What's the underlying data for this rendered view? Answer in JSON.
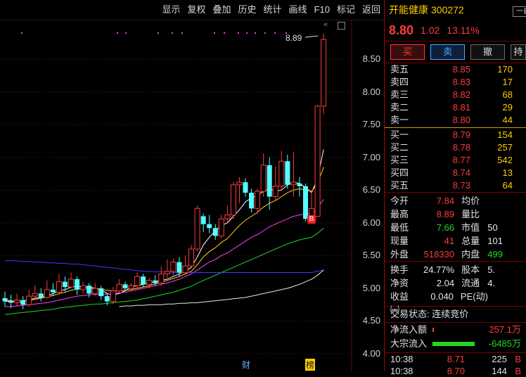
{
  "toolbar": {
    "items": [
      "显示",
      "复权",
      "叠加",
      "历史",
      "统计",
      "画线",
      "F10",
      "标记",
      "返回"
    ]
  },
  "chart": {
    "y_ticks": [
      "8.50",
      "8.00",
      "7.50",
      "7.00",
      "6.50",
      "6.00",
      "5.50",
      "5.00",
      "4.50",
      "4.00"
    ],
    "high_label": "8.89",
    "b_marker": "B",
    "bottom_markers": [
      "财",
      "榜"
    ]
  },
  "chart_data": {
    "type": "candlestick",
    "ylim": [
      3.9,
      8.95
    ],
    "candles": [
      [
        4.85,
        4.8,
        4.95,
        4.72
      ],
      [
        4.8,
        4.78,
        4.9,
        4.7
      ],
      [
        4.78,
        4.82,
        4.92,
        4.72
      ],
      [
        4.82,
        4.75,
        4.88,
        4.68
      ],
      [
        4.75,
        4.88,
        4.98,
        4.72
      ],
      [
        4.88,
        4.92,
        5.05,
        4.82
      ],
      [
        4.92,
        4.86,
        5.0,
        4.8
      ],
      [
        4.86,
        4.98,
        5.12,
        4.84
      ],
      [
        4.98,
        4.94,
        5.08,
        4.88
      ],
      [
        4.94,
        5.1,
        5.22,
        4.9
      ],
      [
        5.1,
        5.02,
        5.18,
        4.95
      ],
      [
        5.02,
        5.14,
        5.24,
        5.0
      ],
      [
        5.14,
        4.98,
        5.18,
        4.9
      ],
      [
        4.98,
        5.04,
        5.1,
        4.92
      ],
      [
        5.04,
        4.92,
        5.08,
        4.86
      ],
      [
        4.92,
        5.0,
        5.08,
        4.88
      ],
      [
        5.0,
        4.88,
        5.04,
        4.82
      ],
      [
        4.88,
        4.8,
        4.92,
        4.74
      ],
      [
        4.8,
        4.96,
        5.02,
        4.76
      ],
      [
        4.96,
        5.06,
        5.14,
        4.92
      ],
      [
        5.06,
        5.0,
        5.1,
        4.96
      ],
      [
        5.0,
        5.04,
        5.08,
        4.96
      ],
      [
        5.04,
        5.18,
        5.24,
        5.0
      ],
      [
        5.18,
        5.06,
        5.22,
        5.02
      ],
      [
        5.06,
        5.12,
        5.16,
        5.0
      ],
      [
        5.12,
        5.08,
        5.2,
        5.04
      ],
      [
        5.08,
        5.22,
        5.34,
        5.04
      ],
      [
        5.22,
        5.26,
        5.44,
        5.16
      ],
      [
        5.26,
        5.4,
        5.46,
        5.2
      ],
      [
        5.4,
        5.24,
        5.48,
        5.18
      ],
      [
        5.24,
        5.34,
        5.5,
        5.2
      ],
      [
        5.34,
        5.6,
        5.66,
        5.3
      ],
      [
        5.6,
        6.22,
        6.26,
        5.56
      ],
      [
        6.1,
        5.98,
        6.14,
        5.86
      ],
      [
        5.98,
        5.92,
        6.12,
        5.84
      ],
      [
        5.92,
        5.8,
        5.98,
        5.74
      ],
      [
        5.8,
        6.06,
        6.12,
        5.76
      ],
      [
        6.06,
        6.12,
        6.26,
        6.0
      ],
      [
        6.12,
        6.58,
        6.62,
        6.06
      ],
      [
        6.58,
        6.62,
        6.7,
        6.3
      ],
      [
        6.62,
        6.46,
        6.68,
        6.4
      ],
      [
        6.46,
        6.22,
        6.52,
        6.16
      ],
      [
        6.22,
        6.48,
        6.52,
        6.14
      ],
      [
        6.48,
        6.88,
        7.06,
        6.4
      ],
      [
        6.88,
        6.4,
        7.0,
        6.2
      ],
      [
        6.4,
        6.56,
        6.86,
        6.34
      ],
      [
        6.56,
        6.94,
        7.1,
        6.5
      ],
      [
        6.94,
        6.58,
        7.04,
        6.52
      ],
      [
        6.58,
        6.62,
        7.08,
        6.4
      ],
      [
        6.6,
        6.56,
        6.7,
        6.4
      ],
      [
        6.56,
        6.06,
        6.6,
        6.02
      ],
      [
        6.06,
        6.22,
        6.5,
        6.02
      ],
      [
        6.1,
        7.78,
        7.8,
        6.1
      ],
      [
        7.78,
        8.8,
        8.89,
        7.66
      ]
    ],
    "ma": [
      {
        "color": "#ffffff",
        "values": [
          4.82,
          4.81,
          4.8,
          4.81,
          4.82,
          4.85,
          4.86,
          4.88,
          4.92,
          4.96,
          4.98,
          5.02,
          5.03,
          5.02,
          5.02,
          5.0,
          4.98,
          4.92,
          4.9,
          4.92,
          4.96,
          5.02,
          5.04,
          5.06,
          5.08,
          5.1,
          5.12,
          5.14,
          5.18,
          5.22,
          5.26,
          5.32,
          5.48,
          5.66,
          5.78,
          5.88,
          5.96,
          6.0,
          6.1,
          6.2,
          6.32,
          6.38,
          6.42,
          6.48,
          6.52,
          6.48,
          6.5,
          6.58,
          6.62,
          6.6,
          6.54,
          6.46,
          6.68,
          7.12
        ]
      },
      {
        "color": "#ffd21f",
        "values": [
          4.8,
          4.8,
          4.8,
          4.81,
          4.82,
          4.83,
          4.85,
          4.87,
          4.89,
          4.92,
          4.94,
          4.97,
          4.99,
          5.0,
          5.0,
          5.0,
          4.99,
          4.97,
          4.96,
          4.96,
          4.97,
          4.98,
          5.0,
          5.02,
          5.04,
          5.07,
          5.09,
          5.12,
          5.15,
          5.18,
          5.22,
          5.26,
          5.36,
          5.48,
          5.56,
          5.62,
          5.7,
          5.76,
          5.86,
          5.96,
          6.04,
          6.1,
          6.16,
          6.24,
          6.3,
          6.34,
          6.4,
          6.46,
          6.5,
          6.52,
          6.5,
          6.48,
          6.6,
          6.85
        ]
      },
      {
        "color": "#ff3bff",
        "values": [
          4.72,
          4.72,
          4.73,
          4.74,
          4.75,
          4.76,
          4.77,
          4.78,
          4.8,
          4.82,
          4.84,
          4.86,
          4.88,
          4.89,
          4.9,
          4.91,
          4.91,
          4.91,
          4.92,
          4.93,
          4.94,
          4.96,
          4.98,
          5.0,
          5.02,
          5.04,
          5.06,
          5.08,
          5.11,
          5.14,
          5.18,
          5.22,
          5.28,
          5.34,
          5.4,
          5.44,
          5.5,
          5.54,
          5.6,
          5.66,
          5.72,
          5.78,
          5.82,
          5.88,
          5.94,
          5.98,
          6.02,
          6.06,
          6.1,
          6.12,
          6.14,
          6.14,
          6.22,
          6.36
        ]
      },
      {
        "color": "#22d622",
        "values": [
          4.6,
          4.61,
          4.62,
          4.63,
          4.64,
          4.65,
          4.66,
          4.67,
          4.68,
          4.7,
          4.71,
          4.72,
          4.73,
          4.74,
          4.75,
          4.76,
          4.76,
          4.77,
          4.78,
          4.79,
          4.8,
          4.81,
          4.82,
          4.84,
          4.86,
          4.88,
          4.9,
          4.92,
          4.94,
          4.97,
          5.0,
          5.03,
          5.08,
          5.12,
          5.16,
          5.2,
          5.24,
          5.28,
          5.32,
          5.36,
          5.4,
          5.44,
          5.48,
          5.52,
          5.56,
          5.6,
          5.64,
          5.68,
          5.71,
          5.74,
          5.76,
          5.78,
          5.84,
          5.92
        ]
      },
      {
        "color": "#3b3bff",
        "values": [
          5.42,
          5.42,
          5.42,
          5.41,
          5.41,
          5.4,
          5.4,
          5.39,
          5.39,
          5.38,
          5.38,
          5.37,
          5.37,
          5.36,
          5.35,
          5.34,
          5.33,
          5.32,
          5.31,
          5.3,
          5.29,
          5.28,
          5.27,
          5.26,
          5.26,
          5.25,
          5.25,
          5.25,
          5.24,
          5.24,
          5.24,
          5.24,
          5.24,
          5.24,
          5.24,
          5.24,
          5.24,
          5.24,
          5.24,
          5.24,
          5.24,
          5.24,
          5.24,
          5.24,
          5.24,
          5.24,
          5.24,
          5.24,
          5.24,
          5.24,
          5.24,
          5.24,
          5.26,
          5.28
        ]
      },
      {
        "color": "#e8e8e8",
        "values": [
          null,
          null,
          null,
          null,
          null,
          null,
          null,
          null,
          null,
          null,
          null,
          null,
          null,
          null,
          null,
          null,
          null,
          null,
          null,
          4.72,
          4.73,
          4.73,
          4.74,
          4.74,
          4.75,
          4.75,
          4.75,
          4.76,
          4.76,
          4.77,
          4.77,
          4.78,
          4.78,
          4.79,
          4.8,
          4.81,
          4.82,
          4.83,
          4.84,
          4.85,
          4.86,
          4.88,
          4.9,
          4.92,
          4.94,
          4.96,
          4.98,
          5.0,
          5.03,
          5.06,
          5.1,
          5.14,
          5.2,
          5.28
        ]
      }
    ]
  },
  "panel": {
    "name": "开能健康",
    "code": "300272",
    "mode": "一自",
    "price": "8.80",
    "change": "1.02",
    "change_pct": "13.11%",
    "buttons": [
      "买",
      "卖",
      "撤",
      "持"
    ],
    "asks": [
      {
        "label": "卖五",
        "price": "8.85",
        "vol": "170"
      },
      {
        "label": "卖四",
        "price": "8.83",
        "vol": "17"
      },
      {
        "label": "卖三",
        "price": "8.82",
        "vol": "68"
      },
      {
        "label": "卖二",
        "price": "8.81",
        "vol": "29"
      },
      {
        "label": "卖一",
        "price": "8.80",
        "vol": "44"
      }
    ],
    "bids": [
      {
        "label": "买一",
        "price": "8.79",
        "vol": "154"
      },
      {
        "label": "买二",
        "price": "8.78",
        "vol": "257"
      },
      {
        "label": "买三",
        "price": "8.77",
        "vol": "542"
      },
      {
        "label": "买四",
        "price": "8.74",
        "vol": "13"
      },
      {
        "label": "买五",
        "price": "8.73",
        "vol": "64"
      }
    ],
    "stats1": [
      {
        "l1": "今开",
        "v1": "7.84",
        "c1": "red",
        "l2": "均价",
        "v2": "",
        "c2": "white"
      },
      {
        "l1": "最高",
        "v1": "8.89",
        "c1": "red",
        "l2": "量比",
        "v2": "",
        "c2": "white"
      },
      {
        "l1": "最低",
        "v1": "7.66",
        "c1": "green",
        "l2": "市值",
        "v2": "50",
        "c2": "white"
      },
      {
        "l1": "现量",
        "v1": "41",
        "c1": "red",
        "l2": "总量",
        "v2": "101",
        "c2": "white"
      },
      {
        "l1": "外盘",
        "v1": "518330",
        "c1": "red",
        "l2": "内盘",
        "v2": "499",
        "c2": "green"
      }
    ],
    "stats2": [
      {
        "l1": "换手",
        "v1": "24.77%",
        "c1": "white",
        "l2": "股本",
        "v2": "5.",
        "c2": "white"
      },
      {
        "l1": "净资",
        "v1": "2.04",
        "c1": "white",
        "l2": "流通",
        "v2": "4.",
        "c2": "white"
      },
      {
        "l1": "收益㈠",
        "v1": "0.040",
        "c1": "white",
        "l2": "PE(动)",
        "v2": "",
        "c2": "white"
      }
    ],
    "status": "交易状态: 连续竞价",
    "flows": [
      {
        "label": "净流入额",
        "value": "257.1万",
        "color": "#ff3b3b",
        "bar": 0.02
      },
      {
        "label": "大宗流入",
        "value": "-6485万",
        "color": "#22d622",
        "bar": 0.6
      }
    ],
    "ticks": [
      {
        "time": "10:38",
        "price": "8.71",
        "vol": "225",
        "dir": "B"
      },
      {
        "time": "10:38",
        "price": "8.70",
        "vol": "144",
        "dir": "B"
      }
    ]
  }
}
